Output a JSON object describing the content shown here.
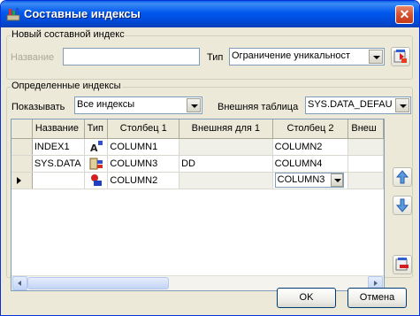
{
  "window": {
    "title": "Составные индексы",
    "close_symbol": "✕"
  },
  "new_index": {
    "legend": "Новый составной индекс",
    "name_label": "Название",
    "name_value": "",
    "type_label": "Тип",
    "type_value": "Ограничение уникальност"
  },
  "defined": {
    "legend": "Определенные индексы",
    "show_label": "Показывать",
    "show_value": "Все индексы",
    "foreign_label": "Внешняя таблица",
    "foreign_value": "SYS.DATA_DEFAU"
  },
  "grid": {
    "columns": [
      "Название",
      "Тип",
      "Столбец 1",
      "Внешняя для 1",
      "Столбец 2",
      "Внеш"
    ],
    "rows": [
      {
        "name": "INDEX1",
        "type_icon": "unique-index-icon",
        "col1": "COLUMN1",
        "foreign1": "",
        "col2": "COLUMN2"
      },
      {
        "name": "SYS.DATA",
        "type_icon": "foreign-key-icon",
        "col1": "COLUMN3",
        "foreign1": "DD",
        "col2": "COLUMN4"
      },
      {
        "name": "",
        "type_icon": "index-icon",
        "col1": "COLUMN2",
        "foreign1": "",
        "col2": "COLUMN3"
      }
    ]
  },
  "buttons": {
    "ok": "OK",
    "cancel": "Отмена"
  },
  "colors": {
    "title_bar": "#0058ee",
    "dialog_bg": "#ece9d8",
    "border": "#7f9db9"
  }
}
